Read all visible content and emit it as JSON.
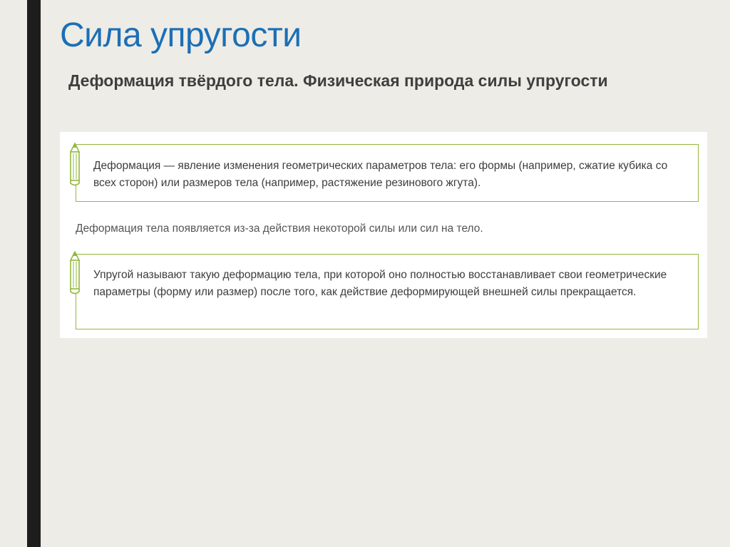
{
  "slide": {
    "title": "Сила упругости",
    "subtitle": "Деформация твёрдого тела. Физическая природа силы упругости"
  },
  "content": {
    "definition_1": "Деформация — явление изменения геометрических параметров тела: его формы (например, сжатие кубика со всех сторон) или размеров тела (например, растяжение резинового жгута).",
    "paragraph": "Деформация тела появляется из-за действия некоторой силы или сил на тело.",
    "definition_2": "Упругой называют такую деформацию тела, при которой оно полностью восстанавливает свои геометрические параметры (форму или размер) после того, как действие деформирующей внешней силы прекращается."
  },
  "colors": {
    "title": "#1b6fb6",
    "accent_green": "#93b73f",
    "left_bar": "#1d1d1d",
    "background": "#eeece6"
  },
  "icons": {
    "definition_marker": "pencil-icon"
  }
}
